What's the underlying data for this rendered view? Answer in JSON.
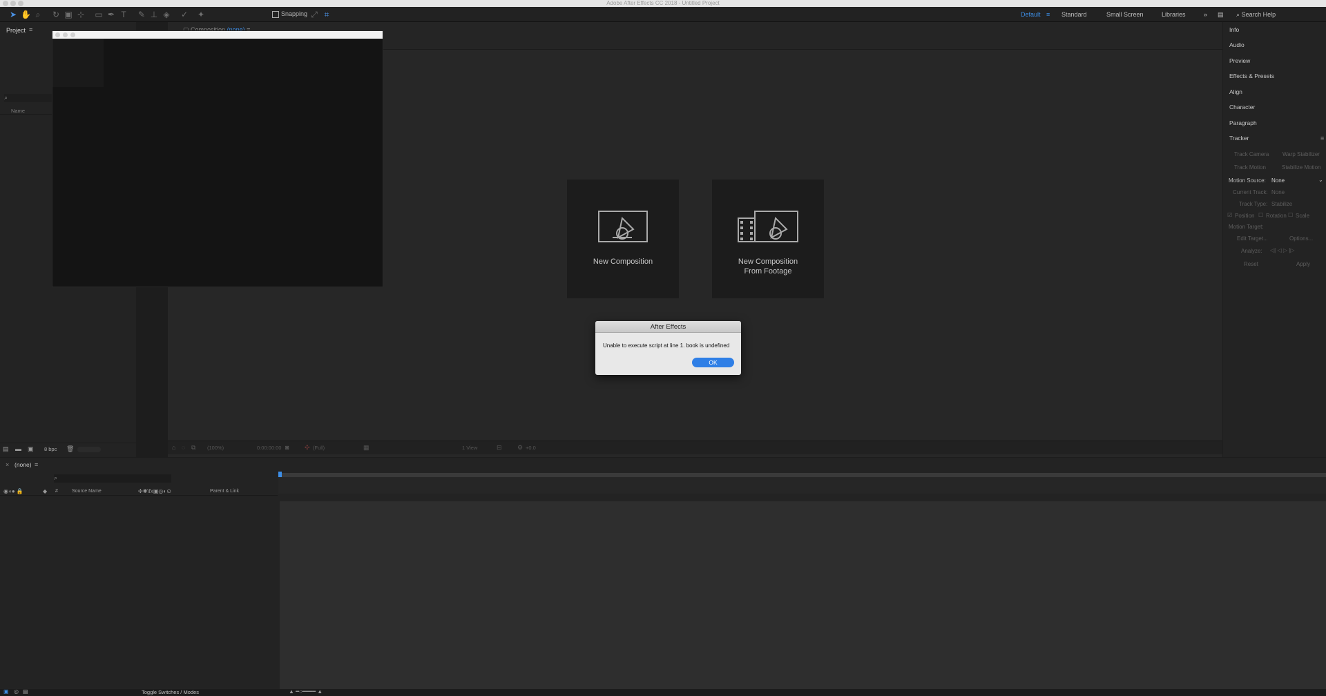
{
  "window": {
    "title": "Adobe After Effects CC 2018 - Untitled Project"
  },
  "toolbar": {
    "snapping_label": "Snapping"
  },
  "workspaces": {
    "items": [
      "Default",
      "Standard",
      "Small Screen",
      "Libraries"
    ],
    "active": "Default"
  },
  "search_help": {
    "placeholder": "Search Help"
  },
  "project_panel": {
    "title": "Project",
    "name_column": "Name",
    "bpc": "8 bpc"
  },
  "composition_panel": {
    "tab_label": "Composition",
    "tab_value": "(none)",
    "cards": [
      {
        "label": "New Composition"
      },
      {
        "label_line1": "New Composition",
        "label_line2": "From Footage"
      }
    ],
    "footer": {
      "zoom": "(100%)",
      "timecode": "0:00:00:00",
      "resolution": "(Full)",
      "view": "1 View",
      "exposure": "+0.0"
    }
  },
  "right_panel": {
    "items": [
      "Info",
      "Audio",
      "Preview",
      "Effects & Presets",
      "Align",
      "Character",
      "Paragraph",
      "Tracker"
    ],
    "tracker": {
      "track_camera": "Track Camera",
      "warp_stabilizer": "Warp Stabilizer",
      "track_motion": "Track Motion",
      "stabilize_motion": "Stabilize Motion",
      "motion_source_label": "Motion Source:",
      "motion_source_value": "None",
      "current_track_label": "Current Track:",
      "current_track_value": "None",
      "track_type_label": "Track Type:",
      "track_type_value": "Stabilize",
      "position": "Position",
      "rotation": "Rotation",
      "scale": "Scale",
      "motion_target": "Motion Target:",
      "edit_target": "Edit Target...",
      "options": "Options...",
      "analyze": "Analyze:",
      "reset": "Reset",
      "apply": "Apply"
    }
  },
  "timeline": {
    "tab_label": "(none)",
    "source_name_col": "Source Name",
    "parent_col": "Parent & Link",
    "toggle_label": "Toggle Switches / Modes"
  },
  "dialog": {
    "title": "After Effects",
    "message": "Unable to execute script at line 1. book is undefined",
    "ok_label": "OK"
  },
  "colors": {
    "accent": "#2f7fe6",
    "background": "#1d1d1d",
    "panel": "#232323"
  }
}
